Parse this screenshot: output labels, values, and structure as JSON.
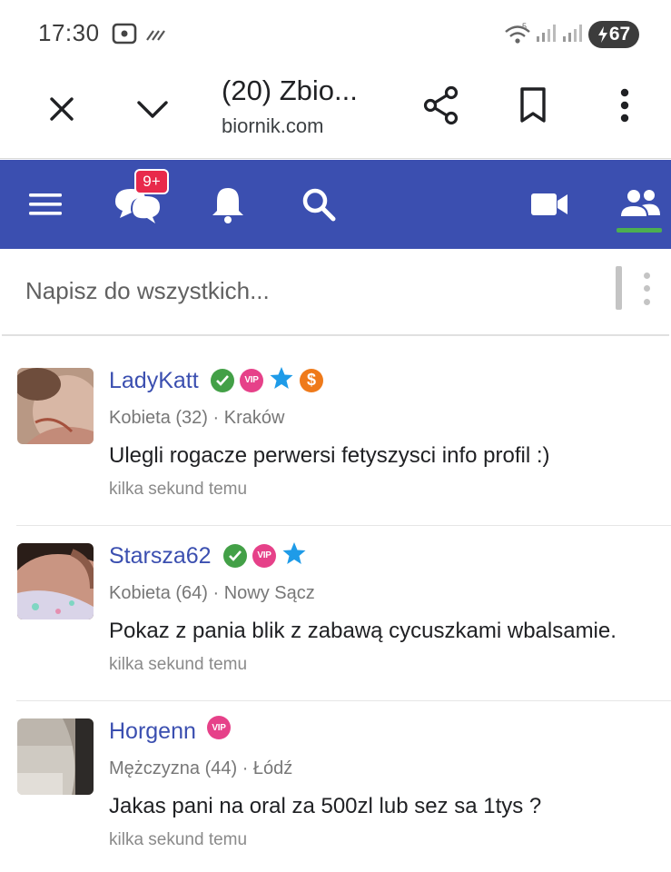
{
  "status_bar": {
    "time": "17:30",
    "battery": "67",
    "icons": [
      "screenshot-icon",
      "data-saver-icon",
      "wifi-icon",
      "signal-icon",
      "signal-icon",
      "battery-charging-icon"
    ]
  },
  "browser": {
    "title": "(20) Zbio...",
    "url": "biornik.com",
    "buttons": [
      "close-icon",
      "chevron-down-icon",
      "share-icon",
      "bookmark-icon",
      "more-vert-icon"
    ]
  },
  "site_nav": {
    "chat_badge": "9+",
    "items": [
      "menu-icon",
      "chat-icon",
      "bell-icon",
      "search-icon",
      "video-camera-icon",
      "people-icon"
    ],
    "active_item": "people-icon",
    "colors": {
      "background": "#3b4fb0",
      "underline": "#4caf50",
      "badge": "#e8294b"
    }
  },
  "compose": {
    "placeholder": "Napisz do wszystkich..."
  },
  "posts": [
    {
      "username": "LadyKatt",
      "badges": [
        "verified-icon",
        "vip-icon",
        "star-icon",
        "dollar-icon"
      ],
      "vip_label": "VIP",
      "coin_label": "$",
      "meta": "Kobieta (32) · Kraków",
      "message": "Ulegli rogacze perwersi fetyszysci info profil :)",
      "time": "kilka sekund temu"
    },
    {
      "username": "Starsza62",
      "badges": [
        "verified-icon",
        "vip-icon",
        "star-icon"
      ],
      "vip_label": "VIP",
      "meta": "Kobieta (64) · Nowy Sącz",
      "message": "Pokaz z pania blik z zabawą cycuszkami wbalsamie.",
      "time": "kilka sekund temu"
    },
    {
      "username": "Horgenn",
      "badges": [
        "vip-icon"
      ],
      "vip_label": "VIP",
      "meta": "Mężczyzna (44) · Łódź",
      "message": "Jakas pani na oral za 500zl lub sez sa 1tys ?",
      "time": "kilka sekund temu"
    }
  ]
}
